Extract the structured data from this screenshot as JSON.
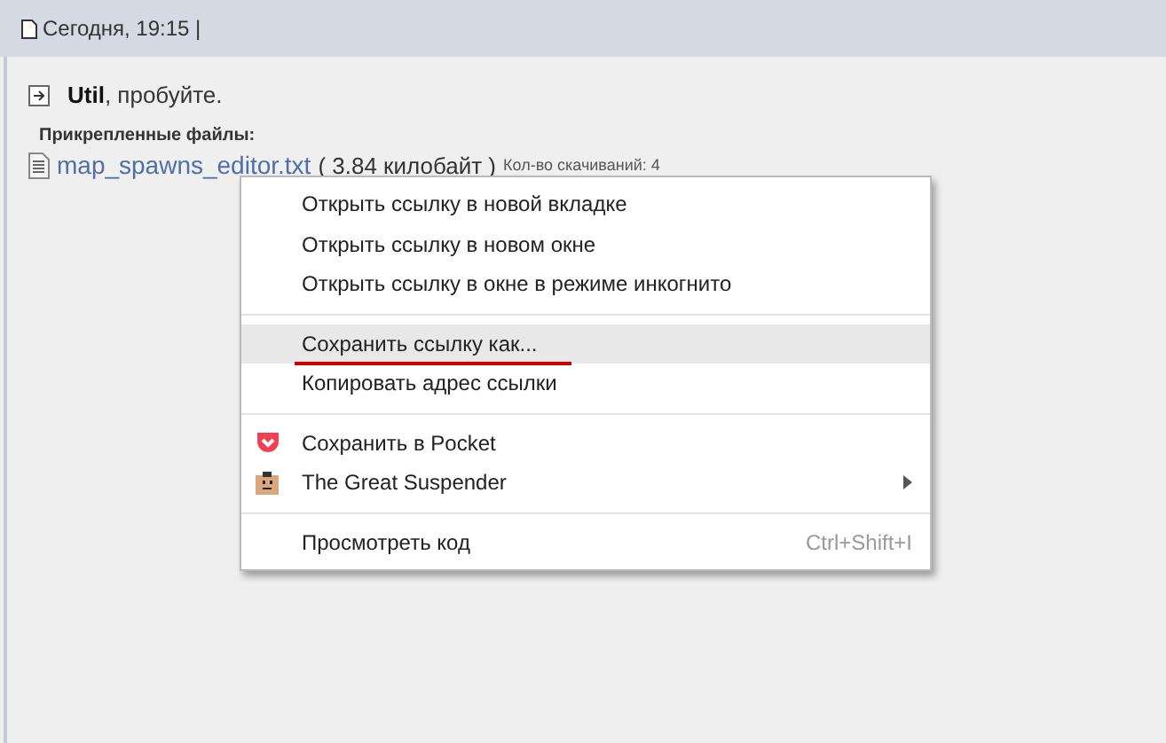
{
  "header": {
    "date": "Сегодня, 19:15 |"
  },
  "post": {
    "text": "**Util**, пробуйте.",
    "attachments_label": "Прикрепленные файлы:",
    "file": {
      "name": "map_spawns_editor.txt",
      "size": "( 3.84 килобайт )",
      "downloads": "Кол-во скачиваний: 4"
    }
  },
  "context_menu": {
    "items": [
      {
        "kind": "item",
        "label": "Открыть ссылку в новой вкладке",
        "selected": false,
        "underlined": false
      },
      {
        "kind": "item",
        "label": "Открыть ссылку в новом окне",
        "selected": false,
        "underlined": false
      },
      {
        "kind": "item",
        "label": "Открыть ссылку в окне в режиме инкогнито",
        "selected": false,
        "underlined": false
      },
      {
        "kind": "separator"
      },
      {
        "kind": "item",
        "label": "Сохранить ссылку как...",
        "selected": true,
        "underlined": true
      },
      {
        "kind": "item",
        "label": "Копировать адрес ссылки",
        "selected": false,
        "underlined": false
      },
      {
        "kind": "separator"
      },
      {
        "kind": "pocket",
        "label": "Сохранить в Pocket",
        "selected": false,
        "underlined": false
      },
      {
        "kind": "extension",
        "label": "The Great Suspender",
        "selected": false,
        "underlined": false,
        "submenu": true
      },
      {
        "kind": "separator"
      },
      {
        "kind": "item",
        "label": "Просмотреть код",
        "selected": false,
        "underlined": false,
        "shortcut": "Ctrl+Shift+I"
      }
    ]
  }
}
